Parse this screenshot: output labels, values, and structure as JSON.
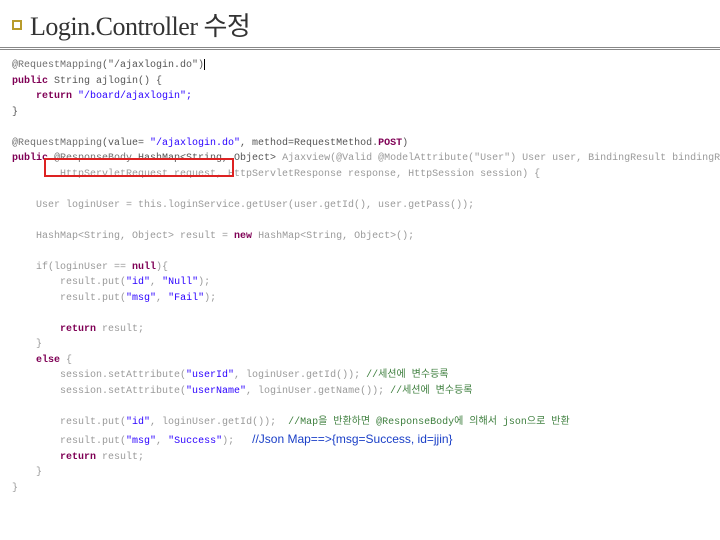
{
  "title": "Login.Controller 수정",
  "code": {
    "l1_ann": "@RequestMapping",
    "l1_arg": "(\"/ajaxlogin.do\")",
    "l2_kw1": "public",
    "l2_type": " String ajlogin() {",
    "l3_kw": "return",
    "l3_str": " \"/board/ajaxlogin\";",
    "l4": "}",
    "l6_ann": "@RequestMapping",
    "l6_args1": "(value= ",
    "l6_str": "\"/ajaxlogin.do\"",
    "l6_args2": ", method=RequestMethod.",
    "l6_post": "POST",
    "l6_close": ")",
    "l7_kw": "public",
    "l7_rb": " @ResponseBody",
    "l7_hm": " HashMap<String, Object>",
    "l7_rest": " Ajaxview(@Valid @ModelAttribute(\"User\") User user, BindingResult bindingResult,",
    "l8": "        HttpServletRequest request, HttpServletResponse response, HttpSession session) {",
    "l10": "    User loginUser = this.loginService.getUser(user.getId(), user.getPass());",
    "l12_a": "    HashMap<String, Object> result = ",
    "l12_kw": "new",
    "l12_b": " HashMap<String, Object>();",
    "l14_a": "    if(loginUser == ",
    "l14_kw": "null",
    "l14_b": "){",
    "l15_a": "        result.put(",
    "l15_s1": "\"id\"",
    "l15_c": ", ",
    "l15_s2": "\"Null\"",
    "l15_e": ");",
    "l16_a": "        result.put(",
    "l16_s1": "\"msg\"",
    "l16_c": ", ",
    "l16_s2": "\"Fail\"",
    "l16_e": ");",
    "l18_kw": "        return",
    "l18_b": " result;",
    "l19": "    }",
    "l20_kw": "    else",
    "l20_b": " {",
    "l21_a": "        session.setAttribute(",
    "l21_s": "\"userId\"",
    "l21_b": ", loginUser.getId()); ",
    "l21_c": "//세션에 변수등록",
    "l22_a": "        session.setAttribute(",
    "l22_s": "\"userName\"",
    "l22_b": ", loginUser.getName()); ",
    "l22_c": "//세션에 변수등록",
    "l24_a": "        result.put(",
    "l24_s1": "\"id\"",
    "l24_c": ", loginUser.getId());  ",
    "l24_cmt": "//Map을 반환하면 @ResponseBody에 의해서 json으로 반환",
    "l25_a": "        result.put(",
    "l25_s1": "\"msg\"",
    "l25_c": ", ",
    "l25_s2": "\"Success\"",
    "l25_e": ");",
    "l26_kw": "        return",
    "l26_b": " result;",
    "l27": "    }",
    "l28": "}"
  },
  "note": "//Json Map==>{msg=Success, id=jjin}"
}
